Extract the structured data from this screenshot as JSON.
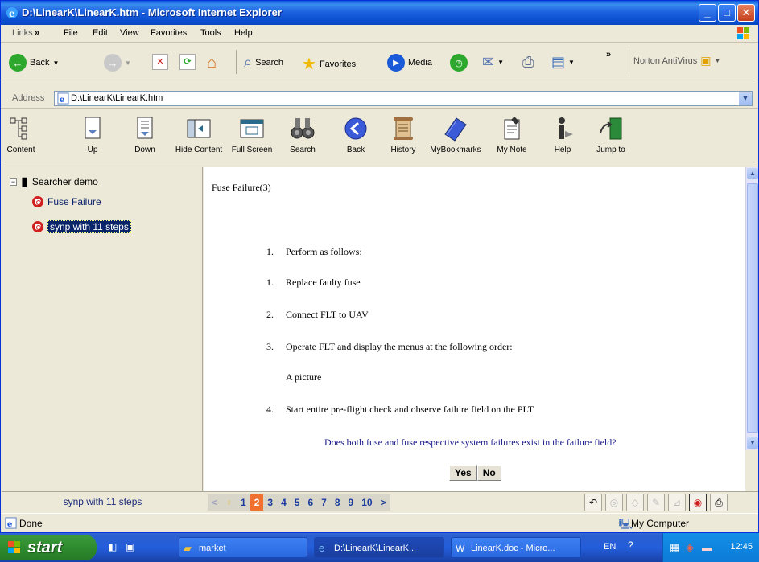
{
  "window": {
    "title": "D:\\LinearK\\LinearK.htm - Microsoft Internet Explorer"
  },
  "menubar": {
    "links": "Links",
    "chevron": "»",
    "items": [
      "File",
      "Edit",
      "View",
      "Favorites",
      "Tools",
      "Help"
    ]
  },
  "std_toolbar": {
    "back": "Back",
    "search": "Search",
    "favorites": "Favorites",
    "media": "Media",
    "norton": "Norton AntiVirus"
  },
  "address": {
    "label": "Address",
    "value": "D:\\LinearK\\LinearK.htm"
  },
  "app_toolbar": {
    "buttons": [
      "Content",
      "Up",
      "Down",
      "Hide Content",
      "Full Screen",
      "Search",
      "Back",
      "History",
      "MyBookmarks",
      "My Note",
      "Help",
      "Jump to"
    ]
  },
  "tree": {
    "root": "Searcher demo",
    "items": [
      "Fuse Failure",
      "synp with 11 steps"
    ]
  },
  "content": {
    "heading": "Fuse Failure(3)",
    "steps": [
      {
        "num": "1.",
        "text": "Perform as follows:"
      },
      {
        "num": "1.",
        "text": "Replace faulty fuse"
      },
      {
        "num": "2.",
        "text": "Connect FLT to UAV"
      },
      {
        "num": "3.",
        "text": "Operate FLT and display the menus at the following order:"
      },
      {
        "num": "",
        "text": "A picture"
      },
      {
        "num": "4.",
        "text": "Start entire pre-flight check and observe failure field on the PLT"
      }
    ],
    "question": "Does both fuse and fuse respective system failures exist in the failure field?",
    "yes": "Yes",
    "no": "No"
  },
  "bottombar": {
    "current": "synp with 11 steps",
    "pages": [
      "1",
      "2",
      "3",
      "4",
      "5",
      "6",
      "7",
      "8",
      "9",
      "10"
    ],
    "active_page": "2",
    "prev": "<",
    "next": ">"
  },
  "status": {
    "left": "Done",
    "right": "My Computer"
  },
  "taskbar": {
    "start": "start",
    "tasks": [
      "market",
      "D:\\LinearK\\LinearK...",
      "LinearK.doc - Micro..."
    ],
    "lang": "EN",
    "clock": "12:45"
  },
  "colors": {
    "title_blue": "#0a5ddc",
    "active_page": "#f07030",
    "question_text": "#1a1a8a"
  }
}
